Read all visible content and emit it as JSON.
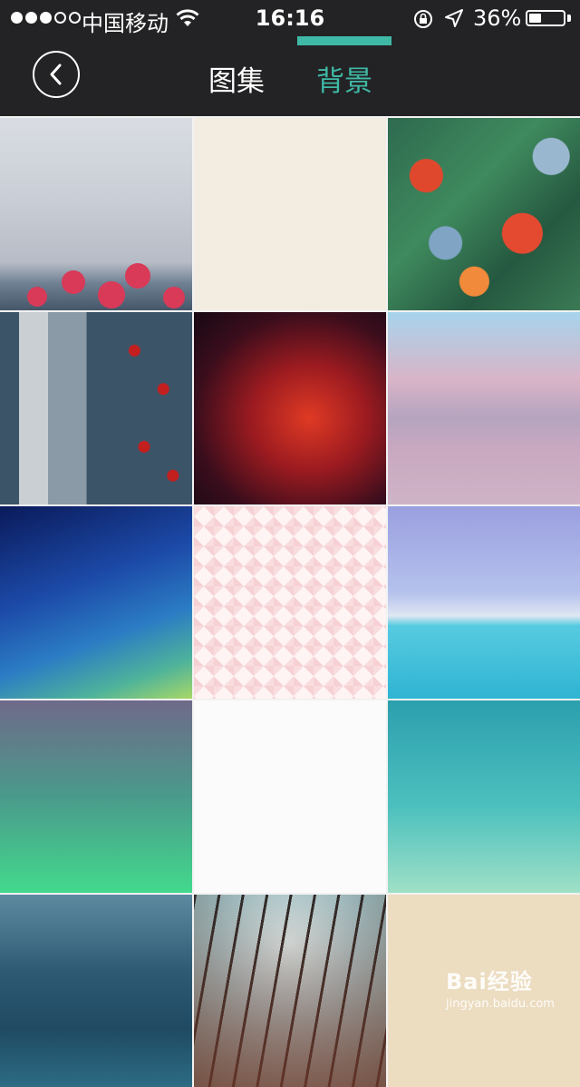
{
  "status_bar": {
    "carrier": "中国移动",
    "time": "16:16",
    "battery_percent": "36%",
    "battery_level": 0.36,
    "signal_bars_filled": 3,
    "signal_bars_total": 5
  },
  "nav": {
    "back_icon": "chevron-left-icon",
    "tabs": [
      {
        "label": "图集",
        "active": false
      },
      {
        "label": "背景",
        "active": true
      }
    ],
    "accent_color": "#3fb9a6",
    "bar_color": "#232325"
  },
  "backgrounds": [
    {
      "name": "cloudy-sky-with-roses"
    },
    {
      "name": "plain-cream"
    },
    {
      "name": "tropical-floral"
    },
    {
      "name": "fish-and-tomatoes"
    },
    {
      "name": "red-nebula"
    },
    {
      "name": "pink-clouds-over-sea"
    },
    {
      "name": "blue-galaxy"
    },
    {
      "name": "pink-gingham"
    },
    {
      "name": "turquoise-ocean"
    },
    {
      "name": "purple-to-green-gradient"
    },
    {
      "name": "plain-white"
    },
    {
      "name": "teal-gradient"
    },
    {
      "name": "ocean-waves"
    },
    {
      "name": "forest-treetops"
    },
    {
      "name": "plain-beige"
    }
  ],
  "watermark": {
    "brand": "Bai经验",
    "url": "jingyan.baidu.com"
  }
}
